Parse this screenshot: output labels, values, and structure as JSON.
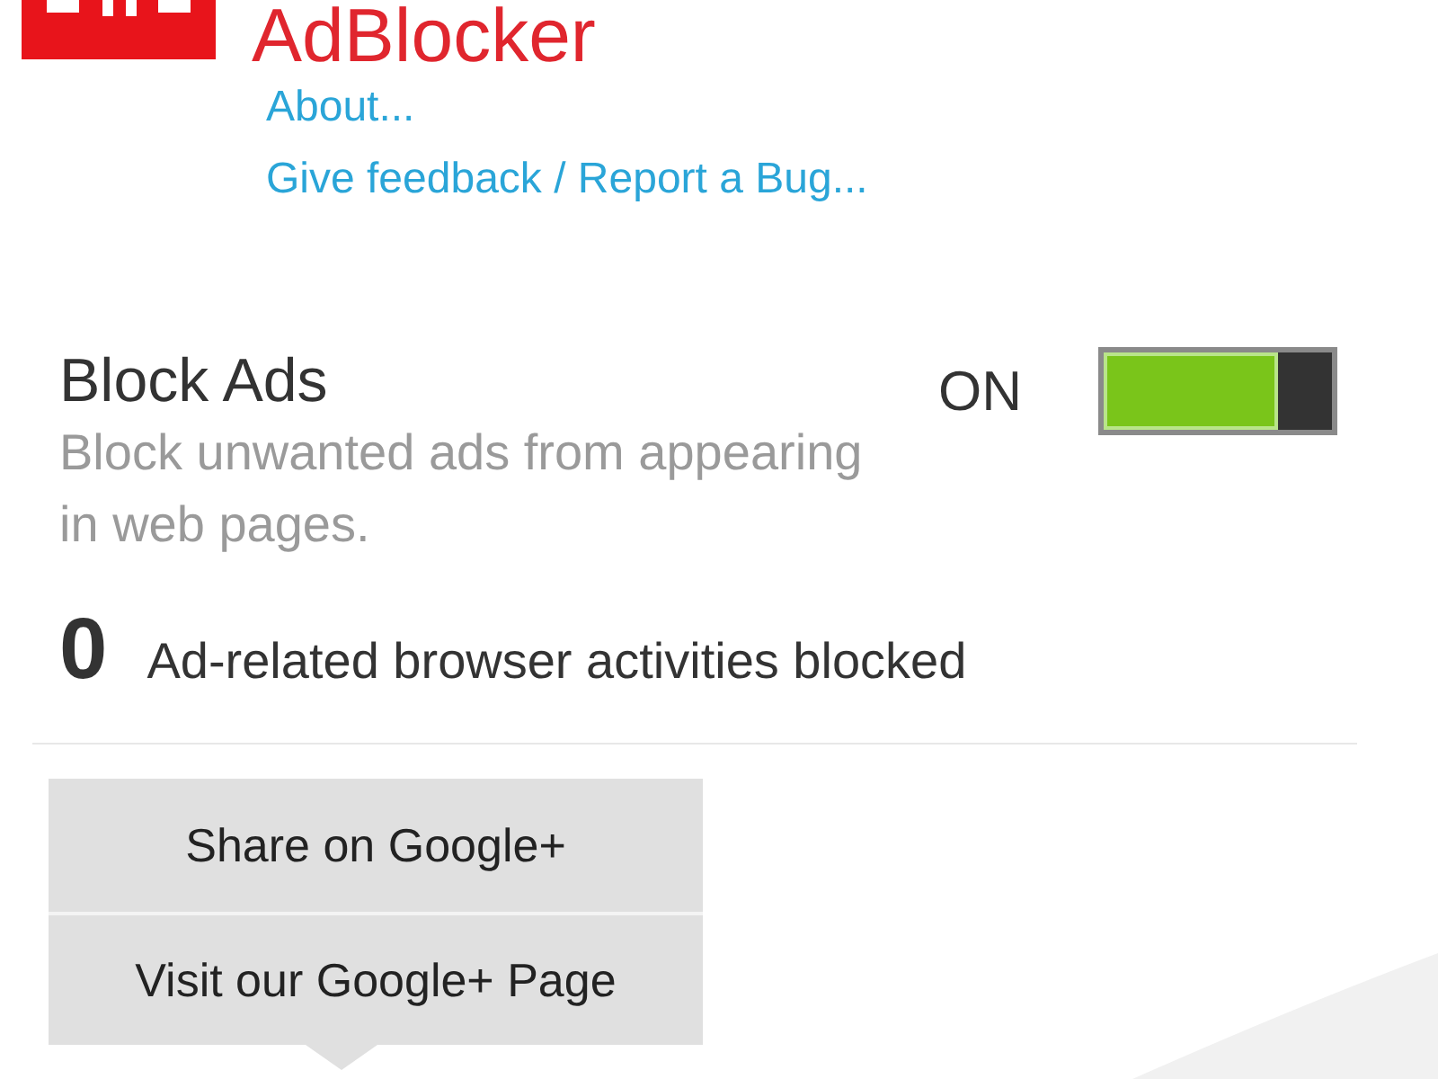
{
  "header": {
    "title": "AdBlocker",
    "links": [
      "About...",
      "Give feedback / Report a Bug..."
    ]
  },
  "block_ads": {
    "title": "Block Ads",
    "description": "Block unwanted ads from appearing in web pages.",
    "state_label": "ON",
    "on": true
  },
  "stats": {
    "count": "0",
    "label": "Ad-related browser activities blocked"
  },
  "share_menu": {
    "items": [
      "Share on Google+",
      "Visit our Google+ Page"
    ]
  }
}
